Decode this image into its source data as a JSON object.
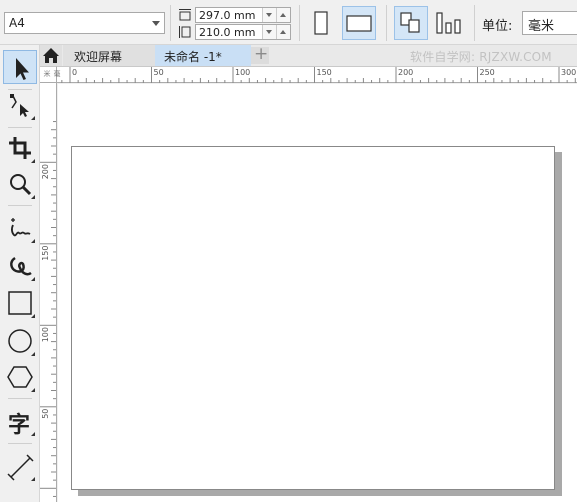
{
  "property_bar": {
    "paper_size": "A4",
    "width_value": "297.0 mm",
    "height_value": "210.0 mm",
    "unit_label": "单位:",
    "unit_value": "毫米"
  },
  "tabs": {
    "welcome_label": "欢迎屏幕",
    "document_label": "未命名 -1*",
    "add_label": "+",
    "watermark": "软件自学网: RJZXW.COM"
  },
  "ruler_h_ticks": [
    "0",
    "50",
    "100",
    "150",
    "200",
    "250",
    "300"
  ],
  "ruler_v_ticks": [
    "200",
    "150",
    "100",
    "50"
  ],
  "ruler_unit": "毫米",
  "tools": [
    "pick-tool",
    "shape-tool",
    "crop-tool",
    "zoom-tool",
    "freehand-tool",
    "artistic-media-tool",
    "rectangle-tool",
    "ellipse-tool",
    "polygon-tool",
    "text-tool",
    "dimension-tool"
  ],
  "text_tool_glyph": "字",
  "colors": {
    "accent": "#c9dff5",
    "selected_tool": "#cfe3f6",
    "page_shadow": "#a9a9a9"
  }
}
